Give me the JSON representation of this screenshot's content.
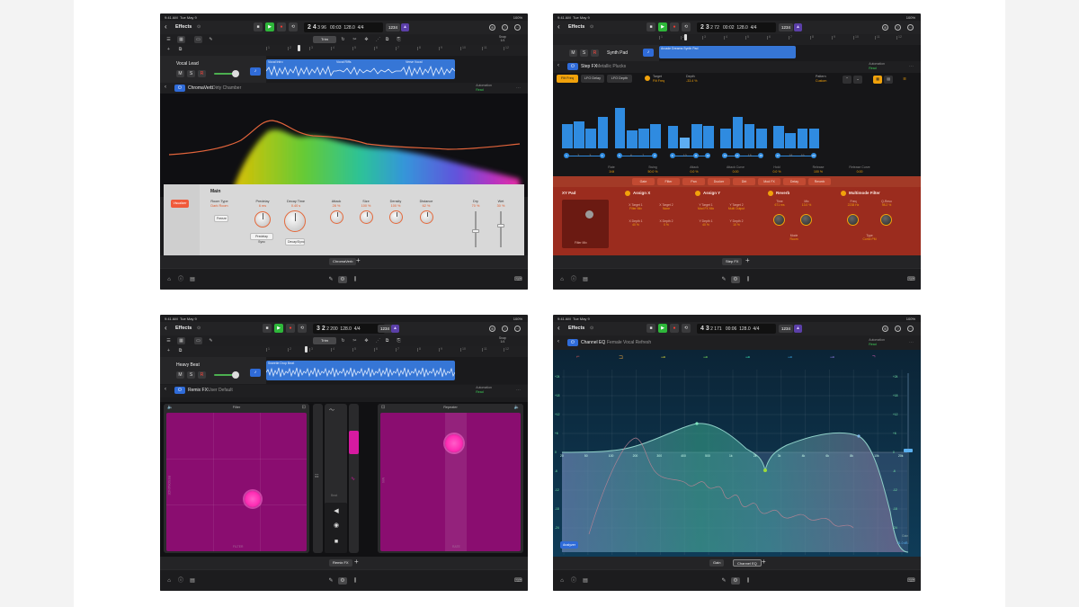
{
  "status": {
    "time": "9:41 AM",
    "date": "Tue May 9",
    "battery": "100%"
  },
  "common": {
    "title": "Effects",
    "lcd_tempo": "128.0",
    "lcd_sig_top": "4/4",
    "lcd_sig_bottom": "A min",
    "count_in": "1234",
    "trim_label": "Trim",
    "snap_top": "Snap",
    "snap_bottom": "1/4",
    "automation_label": "Automation",
    "automation_mode": "Read"
  },
  "s1": {
    "lcd_bar": "2 4",
    "lcd_beat": "3",
    "lcd_tick": "96",
    "lcd_time": "00:03",
    "ruler": [
      "1",
      "2",
      "3",
      "4",
      "5",
      "6",
      "7",
      "8",
      "9",
      "10",
      "11",
      "12"
    ],
    "track": {
      "name": "Vocal Lead",
      "m": "M",
      "s": "S",
      "r": "R"
    },
    "regions": [
      "Vocal Intro",
      "Vocal Riffs",
      "Verse Vocal"
    ],
    "plugin": {
      "name": "ChromaVerb",
      "preset": "Dirty Chamber"
    },
    "main": {
      "title": "Main",
      "vis_btn": "Visualizer",
      "room_type": "Room Type",
      "room_val": "Dark Room",
      "freeze": "Freeze",
      "knobs": [
        {
          "label": "Predelay",
          "value": "6 ms"
        },
        {
          "label": "Decay Time",
          "value": "0.40 s"
        },
        {
          "label": "Attack",
          "value": "28 %"
        },
        {
          "label": "Size",
          "value": "100 %"
        },
        {
          "label": "Density",
          "value": "100 %"
        },
        {
          "label": "Distance",
          "value": "62 %"
        }
      ],
      "predelay_sync": "Predelay Sync",
      "decay_btn": "Decay/Sync",
      "dry_label": "Dry",
      "dry_value": "70 %",
      "wet_label": "Wet",
      "wet_value": "30 %"
    },
    "tab": "ChromaVerb"
  },
  "s2": {
    "lcd_bar": "2 3",
    "lcd_beat": "2",
    "lcd_tick": "72",
    "lcd_time": "00:02",
    "track": {
      "name": "Synth Pad",
      "m": "M",
      "s": "S",
      "r": "R"
    },
    "region": "Arcade Dreams Synth Pad",
    "plugin": {
      "name": "Step FX",
      "preset": "Metallic Plucks"
    },
    "tabs": [
      "Filt Freq",
      "LFO Delay",
      "LFO Depth"
    ],
    "target_label": "Target",
    "target_value": "Filt Freq",
    "depth_label": "Depth",
    "depth_value": "-33.4 %",
    "pattern_label": "Pattern",
    "pattern_value": "Custom",
    "steps": [
      0.55,
      0.6,
      0.45,
      0.7,
      0.9,
      0.4,
      0.45,
      0.55,
      0.5,
      0.25,
      0.55,
      0.5,
      0.45,
      0.7,
      0.55,
      0.45,
      0.5,
      0.35,
      0.45,
      0.45
    ],
    "step_numbers": [
      "1",
      "2",
      "3",
      "4",
      "5",
      "6",
      "7",
      "8",
      "9",
      "10",
      "11",
      "12",
      "13",
      "14",
      "15",
      "16",
      "17",
      "18",
      "19",
      "20"
    ],
    "params": [
      {
        "label": "Rate",
        "value": "1/4t"
      },
      {
        "label": "Swing",
        "value": "50.0 %"
      },
      {
        "label": "Attack",
        "value": "0.0 %"
      },
      {
        "label": "Attack Curve",
        "value": "0.00"
      },
      {
        "label": "Hold",
        "value": "0.0 %"
      },
      {
        "label": "Release",
        "value": "100 %"
      },
      {
        "label": "Release Curve",
        "value": "0.00"
      }
    ],
    "fx_chips": [
      "Gate",
      "Filter",
      "Pan",
      "Ducker",
      "Dirt",
      "Mod FX",
      "Delay",
      "Reverb"
    ],
    "xy_title": "XY Pad",
    "xy_axis": "Filter Mix",
    "assign_x": "Assign X",
    "assign_y": "Assign Y",
    "reverb": "Reverb",
    "multimode": "Multimode Filter",
    "ax_rows": [
      {
        "a": "X Target 1",
        "av": "Filter Mix",
        "b": "X Target 2",
        "bv": "None"
      },
      {
        "a": "X Depth 1",
        "av": "40 %",
        "b": "X Depth 2",
        "bv": "0 %"
      }
    ],
    "ay_rows": [
      {
        "a": "Y Target 1",
        "av": "Mod FX Mix",
        "b": "Y Target 2",
        "bv": "Multi Output"
      },
      {
        "a": "Y Depth 1",
        "av": "40 %",
        "b": "Y Depth 2",
        "bv": "10 %"
      }
    ],
    "rev_knobs": [
      {
        "label": "Time",
        "value": "671 ms"
      },
      {
        "label": "Mix",
        "value": "13.0 %"
      }
    ],
    "rev_mode_label": "Mode",
    "rev_mode_value": "Room",
    "mm_knobs": [
      {
        "label": "Freq",
        "value": "2238 Hz"
      },
      {
        "label": "Q-Reso",
        "value": "98.2 %"
      }
    ],
    "mm_type_label": "Type",
    "mm_type_value": "Comb PM",
    "tab": "Step FX"
  },
  "s3": {
    "lcd_bar": "3 2",
    "lcd_beat": "2",
    "lcd_tick": "200",
    "lcd_time": "",
    "track": {
      "name": "Heavy Beat",
      "m": "M",
      "s": "S",
      "r": "R"
    },
    "region": "Sweetie Drop Beat",
    "plugin": {
      "name": "Remix FX",
      "preset": "User Default"
    },
    "left_title": "Filter",
    "right_title": "Repeater",
    "left_xlabel": "FILTER",
    "left_ylabel": "RESONANCE",
    "right_xlabel": "RATE",
    "right_ylabel": "MIX",
    "mid_label": "Beat",
    "tab": "Remix FX"
  },
  "s4": {
    "lcd_bar": "4 3",
    "lcd_beat": "2",
    "lcd_tick": "171",
    "lcd_time": "00:06",
    "plugin": {
      "name": "Channel EQ",
      "preset": "Female Vocal Refresh"
    },
    "freq_labels": [
      "20",
      "50",
      "100",
      "200",
      "300",
      "400",
      "500",
      "1k",
      "2k",
      "3k",
      "4k",
      "6k",
      "8k",
      "10k",
      "20k"
    ],
    "db_labels": [
      "+24",
      "+18",
      "+12",
      "+6",
      "0",
      "-6",
      "-12",
      "-18",
      "-24"
    ],
    "analyzer_btn": "Analyzer",
    "gain_label": "Gain",
    "gain_value": "-11.0 dB",
    "tabs": [
      "Gain",
      "Channel EQ"
    ]
  }
}
